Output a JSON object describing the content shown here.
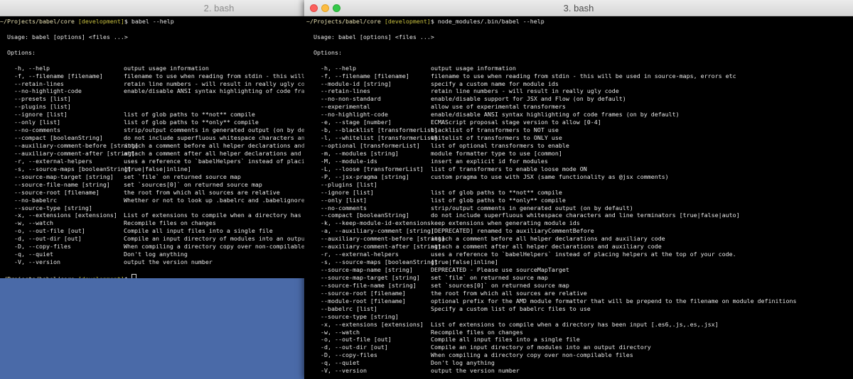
{
  "window1": {
    "title": "2. bash",
    "prompt_path": "~/Projects/babel/core",
    "prompt_branch": "[development]",
    "prompt_symbol": "$",
    "command": "babel --help",
    "usage": "Usage: babel [options] <files ...>",
    "options_header": "Options:",
    "options": [
      [
        "-h, --help",
        "output usage information"
      ],
      [
        "-f, --filename [filename]",
        "filename to use when reading from stdin - this will be used i"
      ],
      [
        "--retain-lines",
        "retain line numbers - will result in really ugly code"
      ],
      [
        "--no-highlight-code",
        "enable/disable ANSI syntax highlighting of code frames (on by"
      ],
      [
        "--presets [list]",
        ""
      ],
      [
        "--plugins [list]",
        ""
      ],
      [
        "--ignore [list]",
        "list of glob paths to **not** compile"
      ],
      [
        "--only [list]",
        "list of glob paths to **only** compile"
      ],
      [
        "--no-comments",
        "strip/output comments in generated output (on by default)"
      ],
      [
        "--compact [booleanString]",
        "do not include superfluous whitespace characters and line ter"
      ],
      [
        "--auxiliary-comment-before [string]",
        "attach a comment before all helper declarations and auxiliary"
      ],
      [
        "--auxiliary-comment-after [string]",
        "attach a comment after all helper declarations and auxiliary"
      ],
      [
        "-r, --external-helpers",
        "uses a reference to `babelHelpers` instead of placing helpers"
      ],
      [
        "-s, --source-maps [booleanString]",
        "[true|false|inline]"
      ],
      [
        "--source-map-target [string]",
        "set `file` on returned source map"
      ],
      [
        "--source-file-name [string]",
        "set `sources[0]` on returned source map"
      ],
      [
        "--source-root [filename]",
        "the root from which all sources are relative"
      ],
      [
        "--no-babelrc",
        "Whether or not to look up .babelrc and .babelignore files"
      ],
      [
        "--source-type [string]",
        ""
      ],
      [
        "-x, --extensions [extensions]",
        "List of extensions to compile when a directory has been input"
      ],
      [
        "-w, --watch",
        "Recompile files on changes"
      ],
      [
        "-o, --out-file [out]",
        "Compile all input files into a single file"
      ],
      [
        "-d, --out-dir [out]",
        "Compile an input directory of modules into an output director"
      ],
      [
        "-D, --copy-files",
        "When compiling a directory copy over non-compilable files"
      ],
      [
        "-q, --quiet",
        "Don't log anything"
      ],
      [
        "-V, --version",
        "output the version number"
      ]
    ]
  },
  "window2": {
    "title": "3. bash",
    "prompt_path": "~/Projects/babel/core",
    "prompt_branch": "[development]",
    "prompt_symbol": "$",
    "command": "node_modules/.bin/babel --help",
    "usage": "Usage: babel [options] <files ...>",
    "options_header": "Options:",
    "options": [
      [
        "-h, --help",
        "output usage information"
      ],
      [
        "-f, --filename [filename]",
        "filename to use when reading from stdin - this will be used in source-maps, errors etc"
      ],
      [
        "--module-id [string]",
        "specify a custom name for module ids"
      ],
      [
        "--retain-lines",
        "retain line numbers - will result in really ugly code"
      ],
      [
        "--no-non-standard",
        "enable/disable support for JSX and Flow (on by default)"
      ],
      [
        "--experimental",
        "allow use of experimental transformers"
      ],
      [
        "--no-highlight-code",
        "enable/disable ANSI syntax highlighting of code frames (on by default)"
      ],
      [
        "-e, --stage [number]",
        "ECMAScript proposal stage version to allow [0-4]"
      ],
      [
        "-b, --blacklist [transformerList]",
        "blacklist of transformers to NOT use"
      ],
      [
        "-l, --whitelist [transformerList]",
        "whitelist of transformers to ONLY use"
      ],
      [
        "--optional [transformerList]",
        "list of optional transformers to enable"
      ],
      [
        "-m, --modules [string]",
        "module formatter type to use [common]"
      ],
      [
        "-M, --module-ids",
        "insert an explicit id for modules"
      ],
      [
        "-L, --loose [transformerList]",
        "list of transformers to enable loose mode ON"
      ],
      [
        "-P, --jsx-pragma [string]",
        "custom pragma to use with JSX (same functionality as @jsx comments)"
      ],
      [
        "--plugins [list]",
        ""
      ],
      [
        "--ignore [list]",
        "list of glob paths to **not** compile"
      ],
      [
        "--only [list]",
        "list of glob paths to **only** compile"
      ],
      [
        "--no-comments",
        "strip/output comments in generated output (on by default)"
      ],
      [
        "--compact [booleanString]",
        "do not include superfluous whitespace characters and line terminators [true|false|auto]"
      ],
      [
        "-k, --keep-module-id-extensions",
        "keep extensions when generating module ids"
      ],
      [
        "-a, --auxiliary-comment [string]",
        "[DEPRECATED] renamed to auxiliaryCommentBefore"
      ],
      [
        "--auxiliary-comment-before [string]",
        "attach a comment before all helper declarations and auxiliary code"
      ],
      [
        "--auxiliary-comment-after [string]",
        "attach a comment after all helper declarations and auxiliary code"
      ],
      [
        "-r, --external-helpers",
        "uses a reference to `babelHelpers` instead of placing helpers at the top of your code."
      ],
      [
        "-s, --source-maps [booleanString]",
        "[true|false|inline]"
      ],
      [
        "--source-map-name [string]",
        "DEPRECATED - Please use sourceMapTarget"
      ],
      [
        "--source-map-target [string]",
        "set `file` on returned source map"
      ],
      [
        "--source-file-name [string]",
        "set `sources[0]` on returned source map"
      ],
      [
        "--source-root [filename]",
        "the root from which all sources are relative"
      ],
      [
        "--module-root [filename]",
        "optional prefix for the AMD module formatter that will be prepend to the filename on module definitions"
      ],
      [
        "--babelrc [list]",
        "Specify a custom list of babelrc files to use"
      ],
      [
        "--source-type [string]",
        ""
      ],
      [
        "-x, --extensions [extensions]",
        "List of extensions to compile when a directory has been input [.es6,.js,.es,.jsx]"
      ],
      [
        "-w, --watch",
        "Recompile files on changes"
      ],
      [
        "-o, --out-file [out]",
        "Compile all input files into a single file"
      ],
      [
        "-d, --out-dir [out]",
        "Compile an input directory of modules into an output directory"
      ],
      [
        "-D, --copy-files",
        "When compiling a directory copy over non-compilable files"
      ],
      [
        "-q, --quiet",
        "Don't log anything"
      ],
      [
        "-V, --version",
        "output the version number"
      ]
    ]
  }
}
